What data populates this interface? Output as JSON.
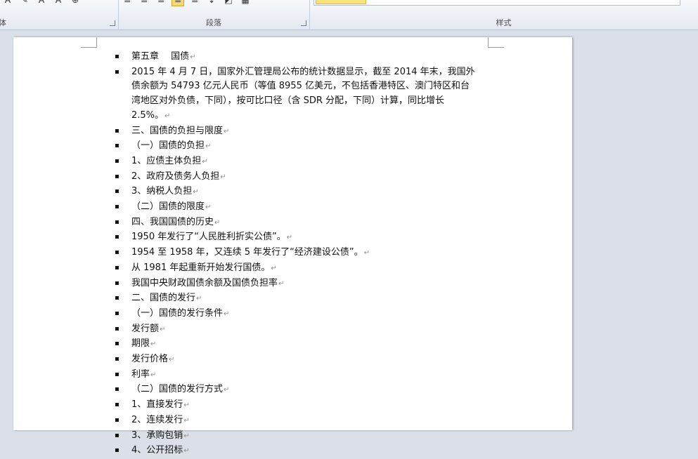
{
  "ribbon": {
    "font_group_label": "体",
    "paragraph_group_label": "段落",
    "styles_group_label": "样式"
  },
  "document": {
    "bullet_char": "▪",
    "paragraph_mark": "↵",
    "items": [
      "第五章　 国债",
      "2015 年 4 月 7 日，国家外汇管理局公布的统计数据显示，截至 2014 年末，我国外债余额为 54793 亿元人民币（等值 8955 亿美元，不包括香港特区、澳门特区和台湾地区对外负债，下同），按可比口径（含 SDR 分配，下同）计算，同比增长 2.5%。",
      "三、国债的负担与限度",
      "（一）国债的负担",
      "1、应债主体负担",
      "2、政府及债务人负担",
      "3、纳税人负担",
      "（二）国债的限度",
      "四、我国国债的历史",
      "1950 年发行了“人民胜利折实公债”。",
      "1954 至 1958 年，又连续 5 年发行了“经济建设公债”。",
      "从 1981 年起重新开始发行国债。",
      "我国中央财政国债余额及国债负担率",
      "二、国债的发行",
      "（一）国债的发行条件",
      "发行额",
      "期限",
      "发行价格",
      "利率",
      "（二）国债的发行方式",
      "1、直接发行",
      "2、连续发行",
      "3、承购包销",
      "4、公开招标"
    ]
  }
}
